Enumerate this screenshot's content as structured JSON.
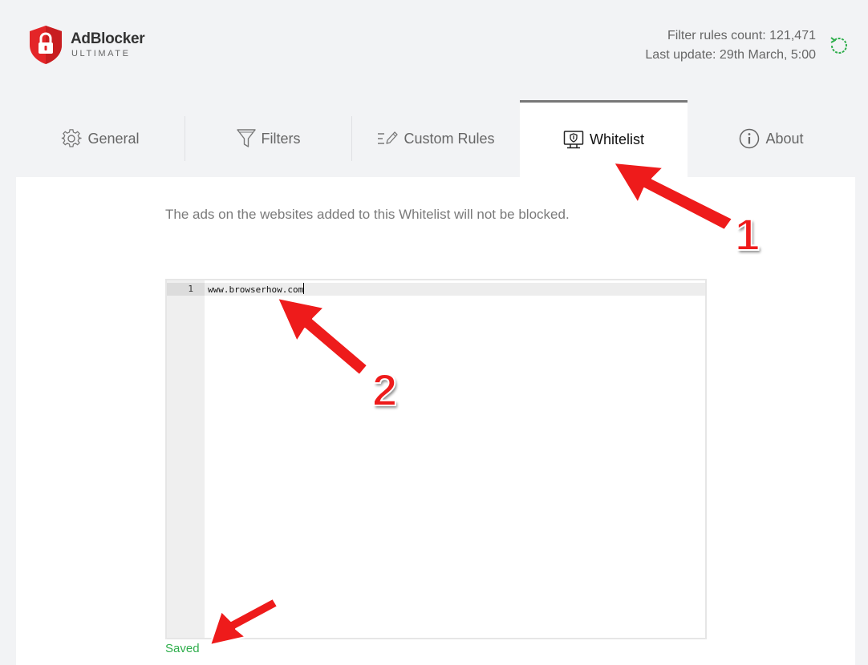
{
  "app": {
    "name": "AdBlocker",
    "subtitle": "ULTIMATE",
    "brand_color": "#e42528"
  },
  "status": {
    "filter_rules": "Filter rules count: 121,471",
    "last_update": "Last update: 29th March, 5:00",
    "refresh_color": "#2fae4c"
  },
  "tabs": [
    {
      "label": "General",
      "icon": "gear-icon"
    },
    {
      "label": "Filters",
      "icon": "filter-funnel-icon"
    },
    {
      "label": "Custom Rules",
      "icon": "list-edit-icon"
    },
    {
      "label": "Whitelist",
      "icon": "monitor-shield-icon",
      "active": true
    },
    {
      "label": "About",
      "icon": "info-icon"
    }
  ],
  "whitelist": {
    "description": "The ads on the websites added to this Whitelist will not be blocked.",
    "line_number": "1",
    "line_text": "www.browserhow.com",
    "saved_label": "Saved",
    "saved_color": "#2fae4c"
  },
  "annotations": {
    "label_1": "1",
    "label_2": "2",
    "arrow_color": "#ee1b1b"
  }
}
